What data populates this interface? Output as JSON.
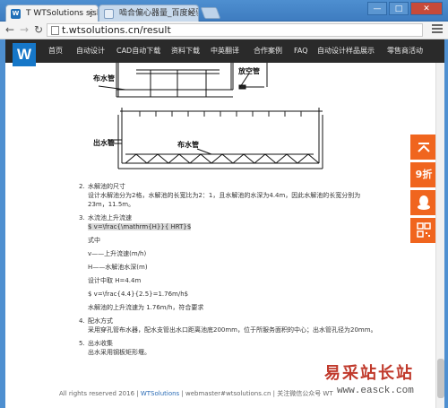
{
  "browser": {
    "tabs": [
      {
        "title": "T WTSolutions sjsh1",
        "active": true
      },
      {
        "title": "啮合偏心器量_百度经验",
        "active": false
      }
    ],
    "url": "t.wtsolutions.cn/result",
    "window_buttons": [
      "—",
      "□",
      "✕"
    ],
    "tab_close_glyph": "×"
  },
  "site": {
    "logo_text": "W",
    "nav": [
      "首页",
      "自动设计",
      "CAD自动下载",
      "资料下载",
      "中英翻译",
      "合作案例",
      "FAQ",
      "自动设计样品展示",
      "零售商活动"
    ]
  },
  "figure": {
    "labels": {
      "top_left": "布水管",
      "top_right": "放空管",
      "bottom_left": "出水管",
      "bottom_mid": "布水管"
    }
  },
  "content": {
    "items": [
      {
        "num": "2.",
        "lines": [
          "水解池的尺寸",
          "设计水解池分为2格，水解池的长宽比为2：1，且水解池的水深为4.4m，因此水解池的长宽分别为",
          "23m，11.5m。"
        ]
      },
      {
        "num": "3.",
        "lines": [
          "水流池上升流速",
          "$ v=\\frac{\\mathrm{H}}{ HRT}$"
        ]
      }
    ],
    "formula_block": [
      "式中",
      "v——上升流速(m/h)",
      "H——水解池水深(m)",
      "设计中取 H=4.4m",
      "$ v=\\frac{4.4}{2.5}=1.76m/h$",
      "水解池的上升流速为 1.76m/h，符合要求"
    ],
    "items2": [
      {
        "num": "4.",
        "lines": [
          "配水方式",
          "采用穿孔管布水器，配水支管出水口距离池底200mm，位于所服务面积的中心；出水管孔径为20mm。"
        ]
      },
      {
        "num": "5.",
        "lines": [
          "出水收集",
          "出水采用钢板矩形堰。"
        ]
      }
    ]
  },
  "footer": {
    "prefix": "All rights reserved 2016 | ",
    "link": "WTSolutions",
    "suffix": " | webmaster#wtsolutions.cn | 关注微信公众号 WT"
  },
  "floatbar": {
    "top_glyph": "⌃",
    "discount": "9折",
    "qq_icon": "qq-penguin-icon",
    "qr_icon": "qr-code-icon"
  },
  "watermark": {
    "title": "易采站长站",
    "url": "www.easck.com"
  },
  "colors": {
    "nav_bg": "#2a2a2a",
    "logo_bg": "#1677c8",
    "float_orange": "#f0651e",
    "link_blue": "#2a6bb5"
  }
}
